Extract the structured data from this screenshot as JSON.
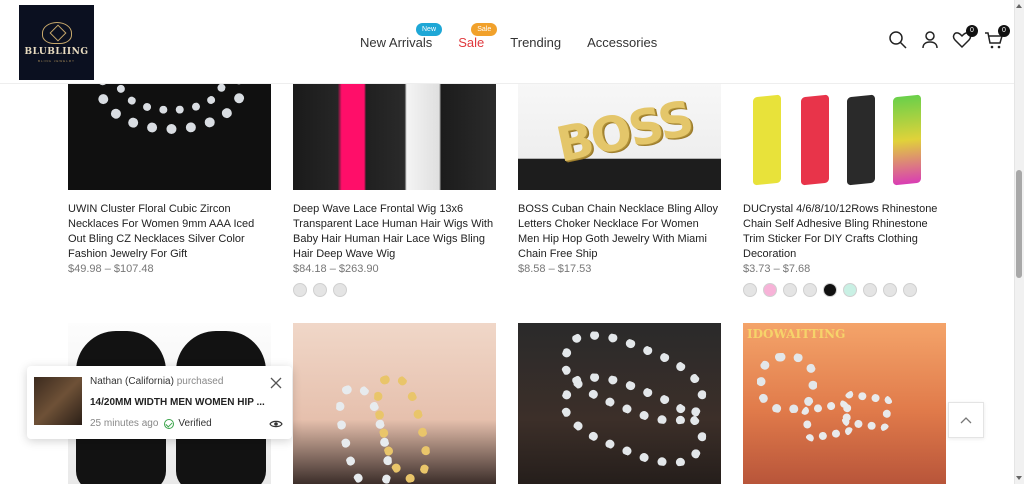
{
  "brand": {
    "logo_text": "BLUBLIING",
    "logo_sub": "BLING JEWELRY"
  },
  "nav": {
    "items": [
      {
        "label": "New Arrivals",
        "badge": "New"
      },
      {
        "label": "Sale",
        "badge": "Sale"
      },
      {
        "label": "Trending"
      },
      {
        "label": "Accessories"
      }
    ]
  },
  "header_icons": {
    "search": "search-icon",
    "account": "user-icon",
    "wishlist": "heart-icon",
    "wishlist_count": "0",
    "cart": "cart-icon",
    "cart_count": "0"
  },
  "products": [
    {
      "title": "UWIN Cluster Floral Cubic Zircon Necklaces For Women 9mm AAA Iced Out Bling CZ Necklaces Silver Color Fashion Jewelry For Gift",
      "price": "$49.98 – $107.48"
    },
    {
      "title": "Deep Wave Lace Frontal Wig 13x6 Transparent Lace Human Hair Wigs With Baby Hair Human Hair Lace Wigs Bling Hair Deep Wave Wig",
      "price": "$84.18 – $263.90",
      "swatches": [
        "#e4e4e4",
        "#e4e4e4",
        "#e4e4e4"
      ]
    },
    {
      "title": "BOSS Cuban Chain Necklace Bling Alloy Letters Choker Necklace For Women Men Hip Hop Goth Jewelry With Miami Chain Free Ship",
      "price": "$8.58 – $17.53",
      "image_text": "BOSS"
    },
    {
      "title": "DUCrystal 4/6/8/10/12Rows Rhinestone Chain Self Adhesive Bling Rhinestone Trim Sticker For DIY Crafts Clothing Decoration",
      "price": "$3.73 – $7.68",
      "swatches": [
        "#e4e4e4",
        "#f7b3d8",
        "#e4e4e4",
        "#e4e4e4",
        "#111111",
        "#c9f0e4",
        "#e4e4e4",
        "#e4e4e4",
        "#e4e4e4",
        "#e4e4e4"
      ]
    }
  ],
  "second_row": {
    "image_text_4": "IDOWAITTING"
  },
  "popup": {
    "buyer": "Nathan (California)",
    "action": "purchased",
    "product": "14/20MM WIDTH MEN WOMEN HIP ...",
    "time": "25 minutes ago",
    "verified": "Verified"
  },
  "colors": {
    "accent_new": "#1ea7d6",
    "accent_sale": "#f1a12b",
    "sale_text": "#e0393e"
  }
}
